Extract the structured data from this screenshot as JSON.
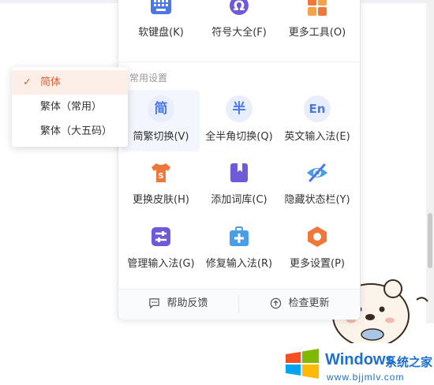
{
  "menu": {
    "top_row": [
      {
        "label": "软键盘(K)",
        "icon": "keyboard-icon"
      },
      {
        "label": "符号大全(F)",
        "icon": "omega-icon"
      },
      {
        "label": "更多工具(O)",
        "icon": "tools-grid-icon"
      }
    ],
    "section_title": "常用设置",
    "settings_row1": [
      {
        "label": "简繁切换(V)",
        "icon_text": "简"
      },
      {
        "label": "全半角切换(Q)",
        "icon_text": "半"
      },
      {
        "label": "英文输入法(E)",
        "icon_text": "En"
      }
    ],
    "settings_row2": [
      {
        "label": "更换皮肤(H)",
        "icon": "tshirt-icon"
      },
      {
        "label": "添加词库(C)",
        "icon": "bookmark-book-icon"
      },
      {
        "label": "隐藏状态栏(Y)",
        "icon": "eye-hidden-icon"
      }
    ],
    "settings_row3": [
      {
        "label": "管理输入法(G)",
        "icon": "sliders-icon"
      },
      {
        "label": "修复输入法(R)",
        "icon": "toolbox-icon"
      },
      {
        "label": "更多设置(P)",
        "icon": "hexagon-gear-icon"
      }
    ],
    "footer": {
      "feedback_label": "帮助反馈",
      "update_label": "检查更新"
    }
  },
  "submenu": {
    "items": [
      {
        "label": "简体",
        "selected": true
      },
      {
        "label": "繁体（常用）",
        "selected": false
      },
      {
        "label": "繁体（大五码）",
        "selected": false
      }
    ],
    "check_glyph": "✓"
  },
  "watermark": {
    "brand": "Windows",
    "brand_cn": "系统之家",
    "url": "www.bjjmlv.com"
  },
  "colors": {
    "accent_orange": "#e25a2c",
    "icon_blue": "#4a78e8",
    "icon_purple": "#6f5bd8",
    "icon_orange": "#f0773a"
  }
}
